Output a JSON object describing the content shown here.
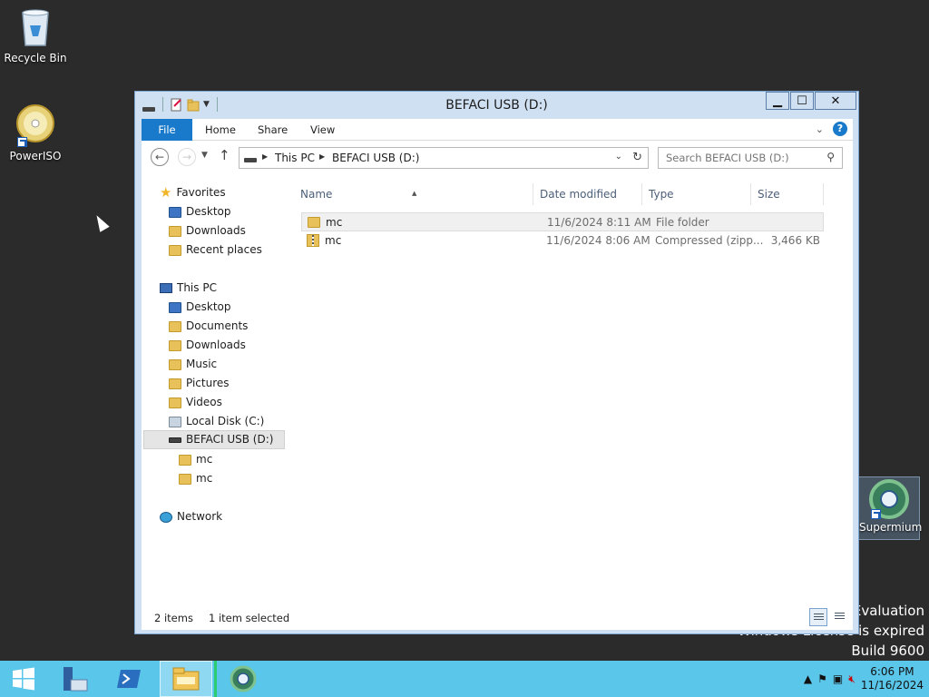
{
  "desktop": {
    "icons": [
      {
        "label": "Recycle Bin",
        "icon": "recycle-bin-icon"
      },
      {
        "label": "PowerISO",
        "icon": "poweriso-icon"
      },
      {
        "label": "Supermium",
        "icon": "supermium-icon"
      }
    ],
    "watermark": {
      "line1": "Evaluation",
      "line2": "Windows License is expired",
      "line3": "Build 9600"
    }
  },
  "window": {
    "title": "BEFACI USB (D:)",
    "buttons": {
      "minimize": "▁",
      "maximize": "☐",
      "close": "✕"
    },
    "ribbon": {
      "tabs": [
        "File",
        "Home",
        "Share",
        "View"
      ]
    },
    "address": {
      "crumbs": [
        "This PC",
        "BEFACI USB (D:)"
      ]
    },
    "search": {
      "placeholder": "Search BEFACI USB (D:)"
    },
    "nav": {
      "favorites_label": "Favorites",
      "favorites": [
        "Desktop",
        "Downloads",
        "Recent places"
      ],
      "thispc_label": "This PC",
      "thispc": [
        "Desktop",
        "Documents",
        "Downloads",
        "Music",
        "Pictures",
        "Videos",
        "Local Disk (C:)",
        "BEFACI USB (D:)"
      ],
      "usb_children": [
        "mc",
        "mc"
      ],
      "network_label": "Network"
    },
    "columns": [
      "Name",
      "Date modified",
      "Type",
      "Size"
    ],
    "files": [
      {
        "name": "mc",
        "date": "11/6/2024 8:11 AM",
        "type": "File folder",
        "size": "",
        "kind": "folder"
      },
      {
        "name": "mc",
        "date": "11/6/2024 8:06 AM",
        "type": "Compressed (zipp...",
        "size": "3,466 KB",
        "kind": "zip"
      }
    ],
    "status": {
      "count": "2 items",
      "selection": "1 item selected"
    }
  },
  "taskbar": {
    "clock_time": "6:06 PM",
    "clock_date": "11/16/2024",
    "colors": {
      "bar": "#5ac6ea",
      "accent": "#1979ca"
    }
  }
}
